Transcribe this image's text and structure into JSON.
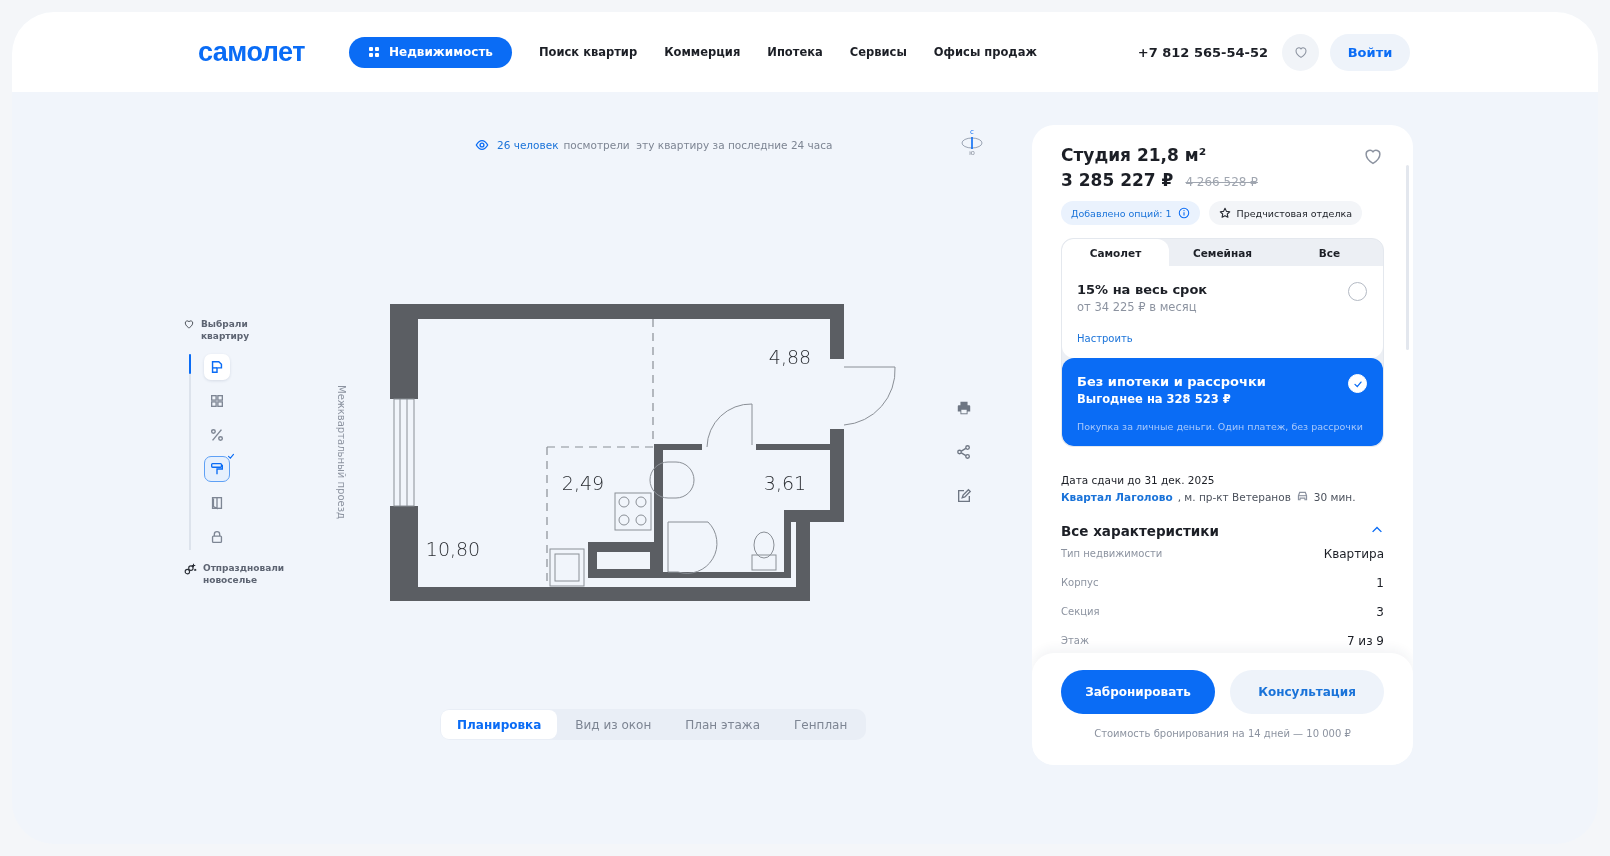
{
  "header": {
    "logo": "самолет",
    "menu_button": "Недвижимость",
    "nav": [
      "Поиск квартир",
      "Коммерция",
      "Ипотека",
      "Сервисы",
      "Офисы продаж"
    ],
    "phone": "+7 812 565-54-52",
    "login": "Войти"
  },
  "viewers": {
    "count": "26 человек",
    "text": "посмотрели  эту квартиру за последние 24 часа"
  },
  "compass": {
    "north": "с",
    "south": "ю"
  },
  "journey": {
    "start": "Выбрали квартиру",
    "end": "Отпраздновали новоселье",
    "progress": {
      "level": 0.1
    },
    "steps": [
      {
        "selected": true,
        "done": false
      },
      {
        "selected": false,
        "done": false
      },
      {
        "selected": false,
        "done": false
      },
      {
        "selected": false,
        "done": true
      },
      {
        "selected": false,
        "done": false
      },
      {
        "selected": false,
        "done": false
      }
    ]
  },
  "plan": {
    "street": "Межквартальный проезд",
    "rooms": [
      {
        "area": "10,80"
      },
      {
        "area": "2,49"
      },
      {
        "area": "4,88"
      },
      {
        "area": "3,61"
      }
    ]
  },
  "view_tabs": [
    {
      "label": "Планировка",
      "selected": true
    },
    {
      "label": "Вид из окон",
      "selected": false
    },
    {
      "label": "План этажа",
      "selected": false
    },
    {
      "label": "Генплан",
      "selected": false
    }
  ],
  "offer": {
    "title": "Студия 21,8 м²",
    "price": "3 285 227 ₽",
    "old_price": "4 266 528 ₽",
    "options_badge": "Добавлено опций: 1",
    "finish_badge": "Предчистовая отделка",
    "payment_tabs": [
      {
        "label": "Самолет",
        "selected": true
      },
      {
        "label": "Семейная",
        "selected": false
      },
      {
        "label": "Все",
        "selected": false
      }
    ],
    "payment_options": [
      {
        "title": "15% на весь срок",
        "subtitle": "от 34 225 ₽ в месяц",
        "action": "Настроить",
        "selected": false
      },
      {
        "title": "Без ипотеки и рассрочки",
        "subtitle": "Выгоднее на 328 523 ₽",
        "note": "Покупка за личные деньги. Один платеж, без рассрочки",
        "selected": true
      }
    ],
    "completion": "Дата сдачи до 31 дек. 2025",
    "district": "Квартал Лаголово",
    "metro": ", м. пр-кт Ветеранов",
    "travel_time": "30 мин.",
    "specs_title": "Все характеристики",
    "specs_expanded": true,
    "specs": [
      {
        "label": "Тип недвижимости",
        "value": "Квартира"
      },
      {
        "label": "Корпус",
        "value": "1"
      },
      {
        "label": "Секция",
        "value": "3"
      },
      {
        "label": "Этаж",
        "value": "7 из 9"
      }
    ],
    "book_button": "Забронировать",
    "consult_button": "Консультация",
    "booking_note": "Стоимость бронирования на 14 дней — 10 000 ₽"
  }
}
